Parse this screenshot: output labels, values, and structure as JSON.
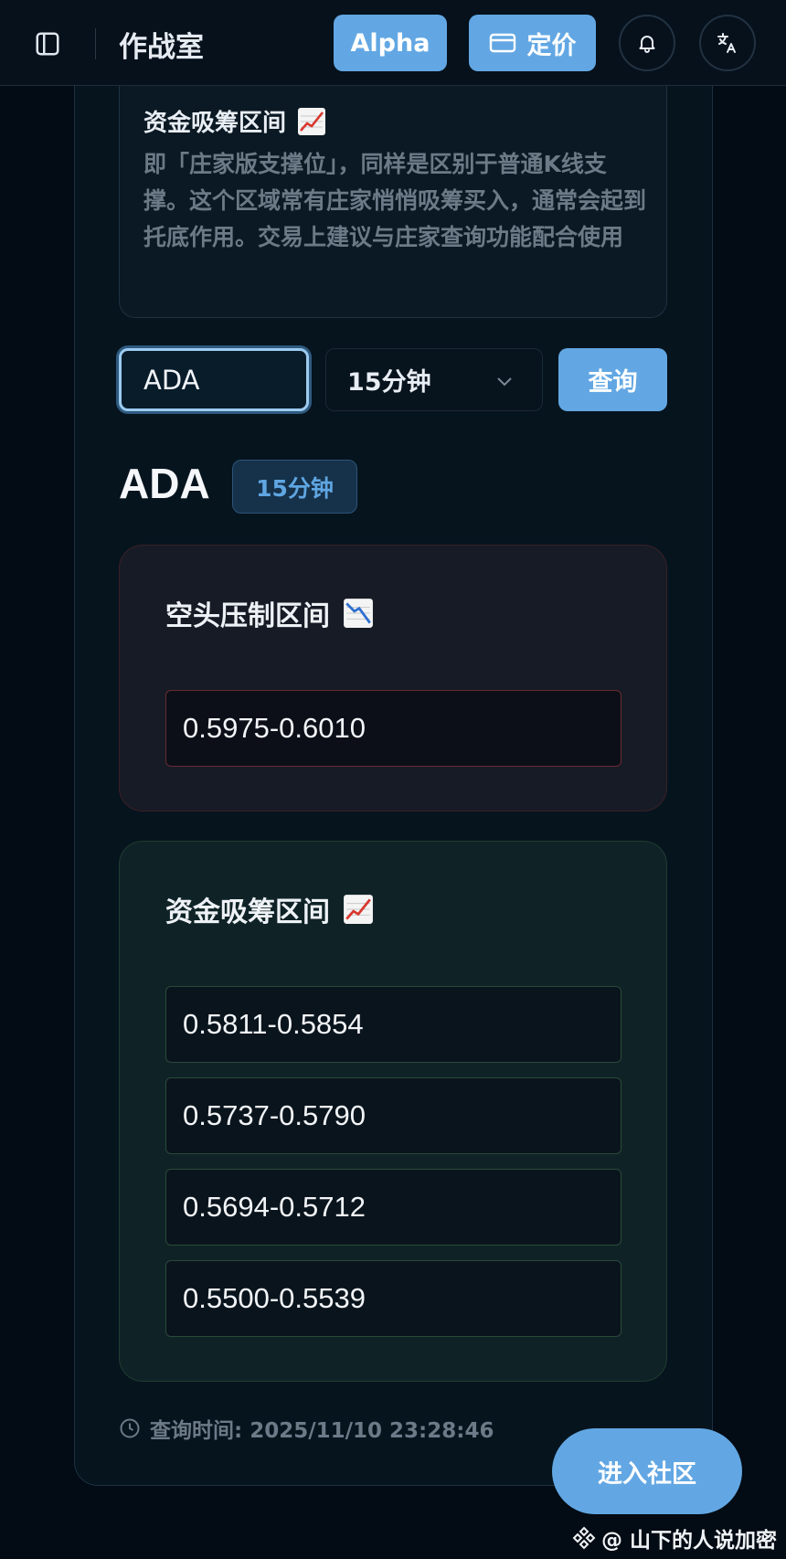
{
  "header": {
    "brand": "作战室",
    "alpha_label": "Alpha",
    "pricing_label": "定价"
  },
  "info": {
    "title": "资金吸筹区间",
    "title_emoji": "📈",
    "description": "即「庄家版支撑位」，同样是区别于普通K线支撑。这个区域常有庄家悄悄吸筹买入，通常会起到托底作用。交易上建议与庄家查询功能配合使用"
  },
  "query": {
    "symbol_value": "ADA",
    "interval_value": "15分钟",
    "query_label": "查询"
  },
  "result": {
    "symbol": "ADA",
    "interval_badge": "15分钟",
    "bear_zone": {
      "title": "空头压制区间",
      "emoji": "📉",
      "ranges": [
        "0.5975-0.6010"
      ]
    },
    "bull_zone": {
      "title": "资金吸筹区间",
      "emoji": "📈",
      "ranges": [
        "0.5811-0.5854",
        "0.5737-0.5790",
        "0.5694-0.5712",
        "0.5500-0.5539"
      ]
    },
    "query_time": "查询时间: 2025/11/10 23:28:46"
  },
  "footer": {
    "community_label": "进入社区",
    "watermark": "@ 山下的人说加密"
  },
  "colors": {
    "accent": "#62a7e3",
    "background": "#030b14",
    "bear_border": "#6a2a33",
    "bull_border": "#2a4a38"
  },
  "icons": [
    "sidebar-toggle-icon",
    "credit-card-icon",
    "bell-icon",
    "translate-icon",
    "chart-up-icon",
    "chart-down-icon",
    "chevron-down-icon",
    "clock-icon",
    "binance-logo-icon"
  ]
}
